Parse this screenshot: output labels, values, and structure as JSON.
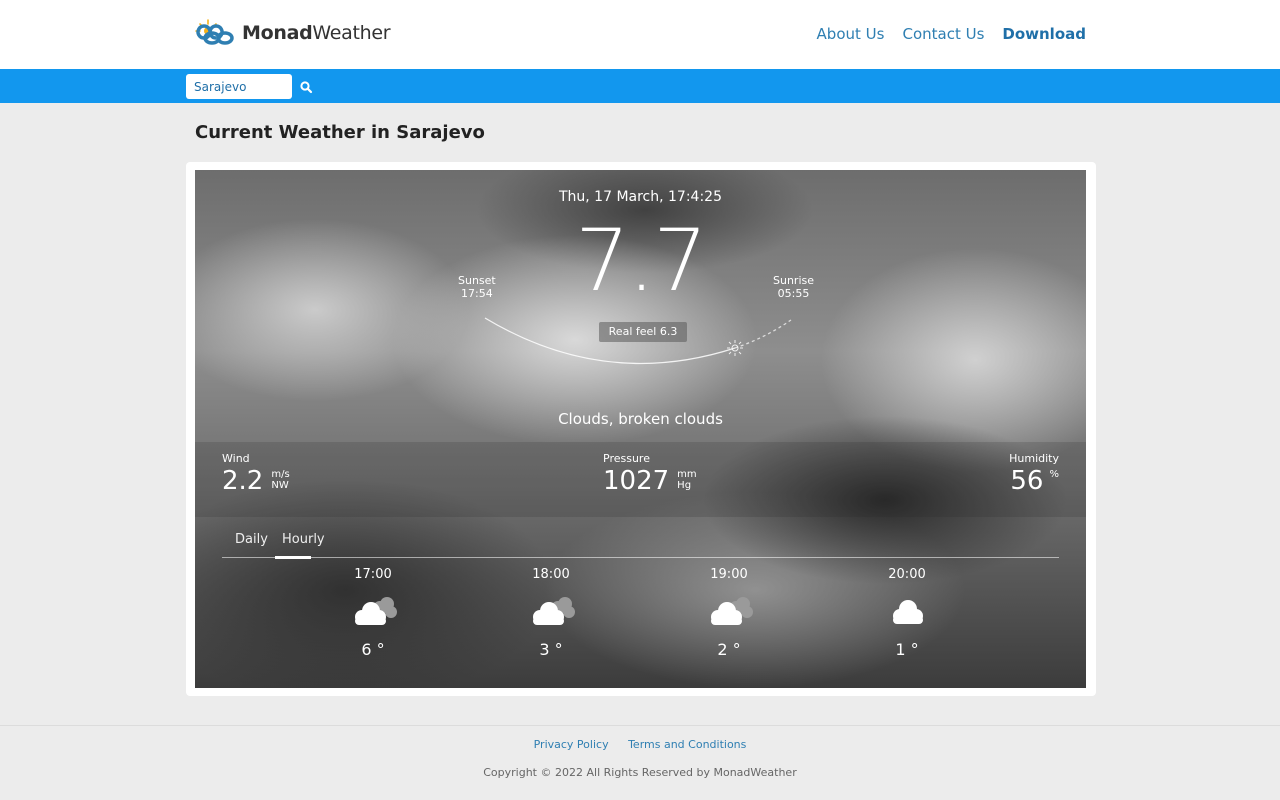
{
  "header": {
    "logo_bold": "Monad",
    "logo_light": "Weather",
    "nav": {
      "about": "About Us",
      "contact": "Contact Us",
      "download": "Download"
    }
  },
  "search": {
    "value": "Sarajevo",
    "icon": "search-icon"
  },
  "title": {
    "prefix": "Current Weather in ",
    "city": "Sarajevo"
  },
  "weather": {
    "datetime": "Thu, 17 March, 17:4:25",
    "temperature": "7.7",
    "sunset_label": "Sunset",
    "sunset_time": "17:54",
    "sunrise_label": "Sunrise",
    "sunrise_time": "05:55",
    "real_feel": "Real feel 6.3",
    "condition": "Clouds, broken clouds",
    "wind": {
      "label": "Wind",
      "value": "2.2",
      "unit": "m/s",
      "dir": "NW"
    },
    "pressure": {
      "label": "Pressure",
      "value": "1027",
      "unit1": "mm",
      "unit2": "Hg"
    },
    "humidity": {
      "label": "Humidity",
      "value": "56",
      "unit": "%"
    }
  },
  "tabs": {
    "daily": "Daily",
    "hourly": "Hourly",
    "active": "hourly"
  },
  "hourly": [
    {
      "time": "17:00",
      "temp": "6 °",
      "icon": "broken-clouds-icon"
    },
    {
      "time": "18:00",
      "temp": "3 °",
      "icon": "broken-clouds-icon"
    },
    {
      "time": "19:00",
      "temp": "2 °",
      "icon": "broken-clouds-icon"
    },
    {
      "time": "20:00",
      "temp": "1 °",
      "icon": "cloud-icon"
    }
  ],
  "footer": {
    "privacy": "Privacy Policy",
    "terms": "Terms and Conditions",
    "copyright": "Copyright © 2022 All Rights Reserved by MonadWeather"
  },
  "colors": {
    "accent": "#1297ee",
    "link": "#2f7fb2",
    "background": "#ececec"
  }
}
